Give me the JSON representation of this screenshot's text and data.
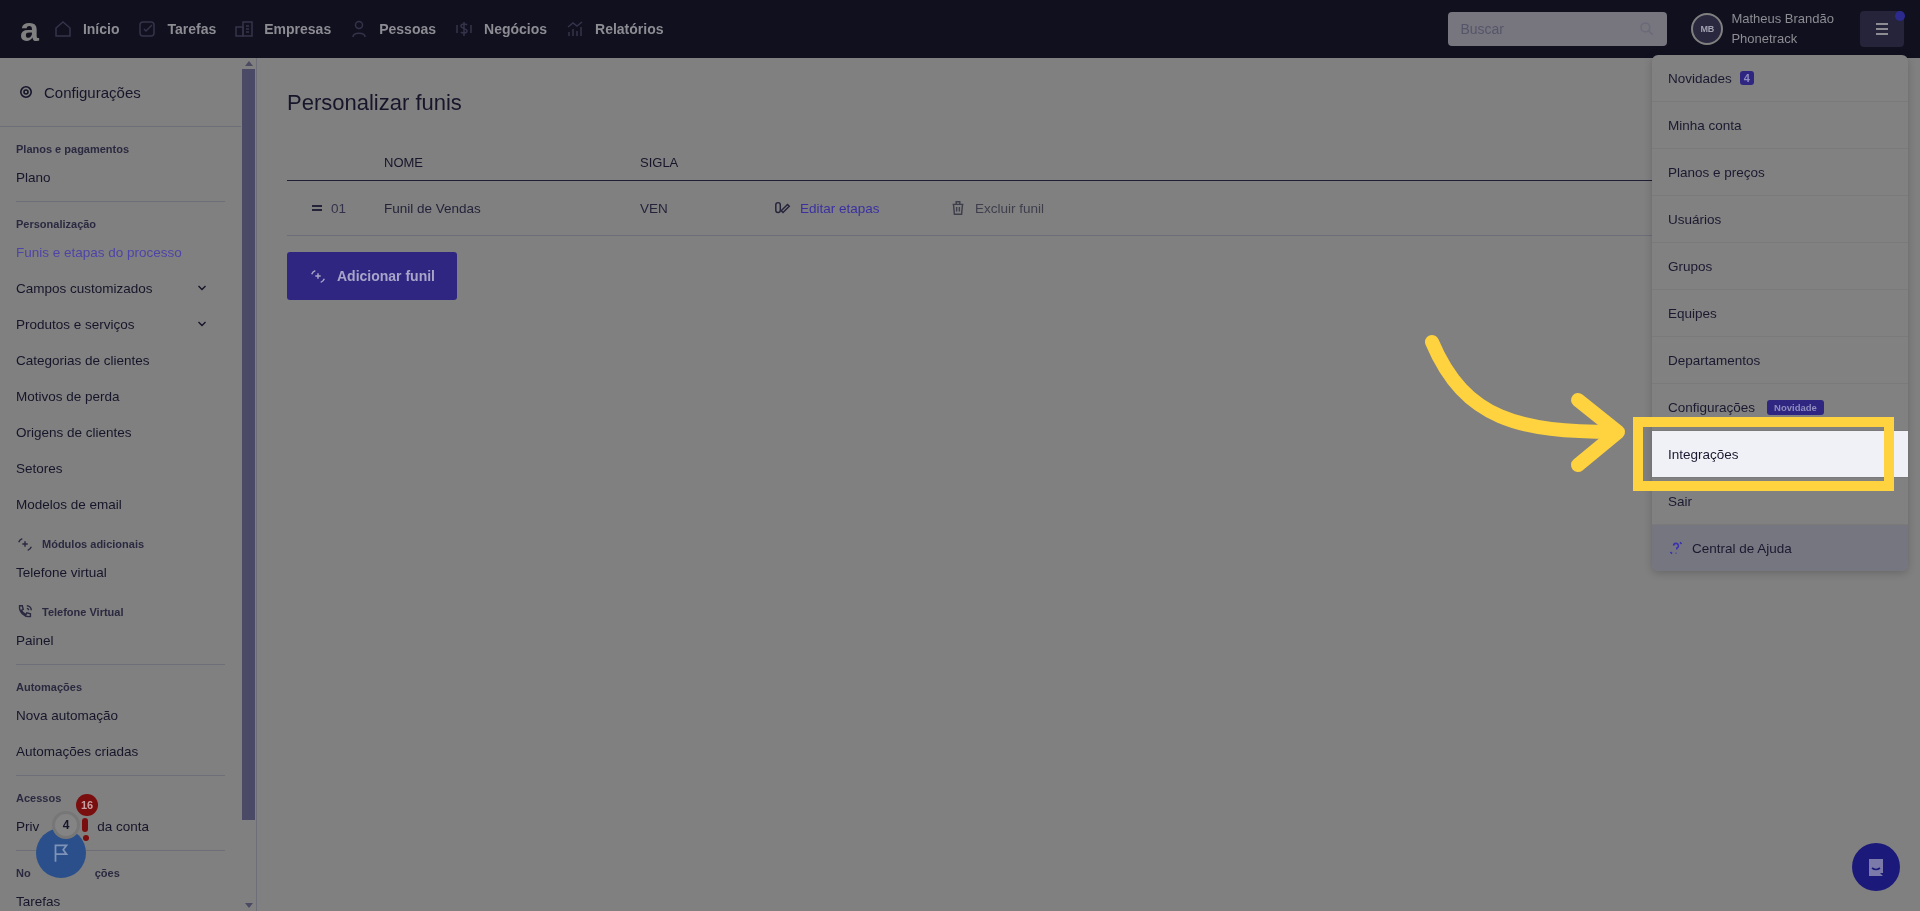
{
  "topbar": {
    "logo": "a",
    "nav": [
      {
        "kind": "home",
        "label": "Início"
      },
      {
        "kind": "tasks",
        "label": "Tarefas"
      },
      {
        "kind": "companies",
        "label": "Empresas"
      },
      {
        "kind": "people",
        "label": "Pessoas"
      },
      {
        "kind": "deals",
        "label": "Negócios"
      },
      {
        "kind": "reports",
        "label": "Relatórios"
      }
    ],
    "search": {
      "placeholder": "Buscar"
    },
    "user": {
      "initials": "MB",
      "name": "Matheus Brandão",
      "company": "Phonetrack"
    }
  },
  "sidebar": {
    "title": "Configurações",
    "sections": [
      {
        "kind": "plain",
        "title": "Planos e pagamentos",
        "items": [
          {
            "label": "Plano",
            "selected": false
          }
        ]
      },
      {
        "kind": "plain",
        "title": "Personalização",
        "items": [
          {
            "label": "Funis e etapas do processo",
            "selected": true
          },
          {
            "label": "Campos customizados",
            "selected": false,
            "expandable": true
          },
          {
            "label": "Produtos e serviços",
            "selected": false,
            "expandable": true
          },
          {
            "label": "Categorias de clientes",
            "selected": false
          },
          {
            "label": "Motivos de perda",
            "selected": false
          },
          {
            "label": "Origens de clientes",
            "selected": false
          },
          {
            "label": "Setores",
            "selected": false
          },
          {
            "label": "Modelos de email",
            "selected": false
          }
        ]
      },
      {
        "kind": "plus",
        "title": "Módulos adicionais",
        "items": [
          {
            "label": "Telefone virtual",
            "selected": false
          }
        ]
      },
      {
        "kind": "phone",
        "title": "Telefone Virtual",
        "items": [
          {
            "label": "Painel",
            "selected": false
          }
        ]
      },
      {
        "kind": "plain",
        "title": "Automações",
        "items": [
          {
            "label": "Nova automação",
            "selected": false
          },
          {
            "label": "Automações criadas",
            "selected": false
          }
        ]
      },
      {
        "kind": "plain",
        "title": "Acessos",
        "items": [
          {
            "label": "Priv",
            "label_after": "da conta",
            "selected": false
          }
        ]
      },
      {
        "kind": "plain",
        "title": "No",
        "title_after": "ções",
        "items": [
          {
            "label": "Tarefas",
            "selected": false
          }
        ]
      }
    ]
  },
  "widget": {
    "count": "4",
    "badge": "16"
  },
  "main": {
    "title": "Personalizar funis",
    "columns": [
      "NOME",
      "SIGLA"
    ],
    "rows": [
      {
        "index": "01",
        "name": "Funil de Vendas",
        "sigla": "VEN",
        "actions": [
          {
            "kind": "edit",
            "label": "Editar etapas"
          },
          {
            "kind": "delete",
            "label": "Excluir funil"
          }
        ]
      }
    ],
    "add_button": "Adicionar funil"
  },
  "menu": {
    "items": [
      {
        "kind": "count",
        "label": "Novidades",
        "badge": "4",
        "selected": false
      },
      {
        "kind": "plain",
        "label": "Minha conta",
        "selected": false
      },
      {
        "kind": "plain",
        "label": "Planos e preços",
        "selected": false
      },
      {
        "kind": "plain",
        "label": "Usuários",
        "selected": false
      },
      {
        "kind": "plain",
        "label": "Grupos",
        "selected": false
      },
      {
        "kind": "plain",
        "label": "Equipes",
        "selected": false
      },
      {
        "kind": "plain",
        "label": "Departamentos",
        "selected": false
      },
      {
        "kind": "tag",
        "label": "Configurações",
        "badge": "Novidade",
        "selected": false
      },
      {
        "kind": "plain",
        "label": "Integrações",
        "selected": true
      },
      {
        "kind": "plain",
        "label": "Sair",
        "selected": false
      }
    ],
    "help": "Central de Ajuda"
  }
}
